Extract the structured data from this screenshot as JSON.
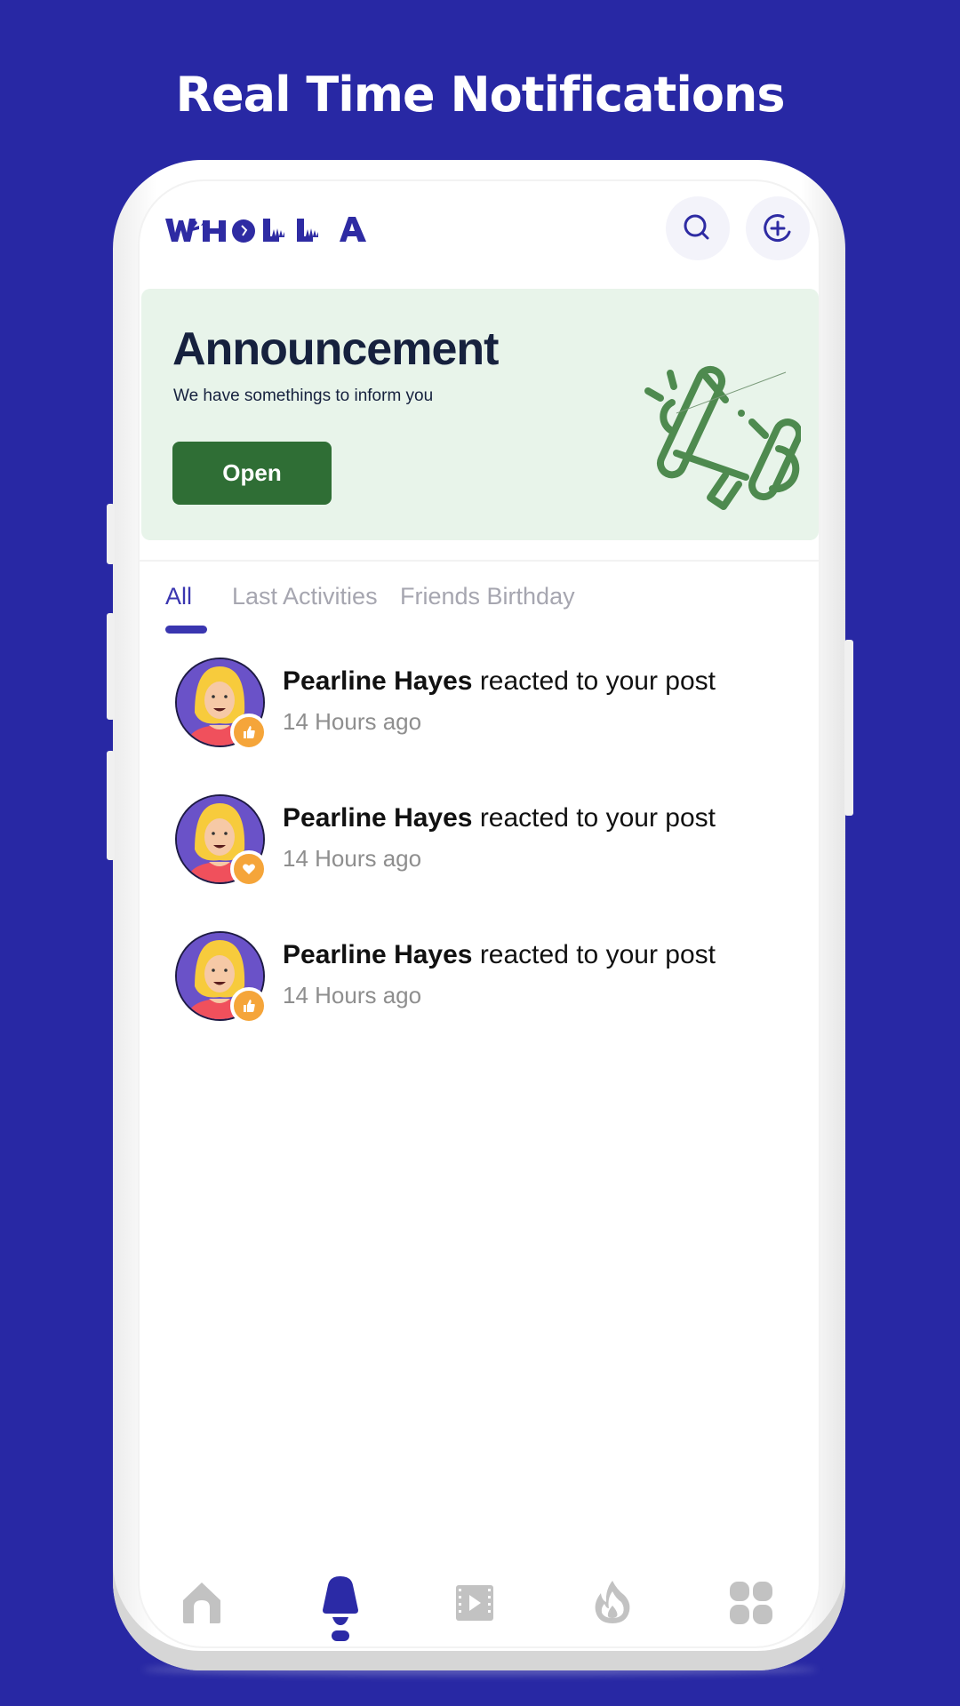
{
  "promo": {
    "title": "Real Time Notifications"
  },
  "colors": {
    "background": "#2828A4",
    "brand": "#2E2BA3",
    "card_bg": "#E8F4EA",
    "open_button": "#2F6E35",
    "reaction_badge": "#F5A53A",
    "nav_inactive": "#C2C2C2"
  },
  "app": {
    "logo_text": "WHOLLA",
    "header": {
      "search_icon": "search-icon",
      "add_icon": "plus-circle-icon"
    },
    "announcement": {
      "title": "Announcement",
      "subtitle": "We have somethings to inform you",
      "button_label": "Open",
      "illustration": "megaphone-icon"
    },
    "tabs": [
      {
        "label": "All",
        "active": true
      },
      {
        "label": "Last Activities",
        "active": false
      },
      {
        "label": "Friends Birthday",
        "active": false
      }
    ],
    "notifications": [
      {
        "name": "Pearline Hayes",
        "action": " reacted to your post",
        "time": "14 Hours ago",
        "reaction": "thumbs-up-icon"
      },
      {
        "name": "Pearline Hayes",
        "action": " reacted to your post",
        "time": "14 Hours ago",
        "reaction": "heart-icon"
      },
      {
        "name": "Pearline Hayes",
        "action": " reacted to your post",
        "time": "14 Hours ago",
        "reaction": "thumbs-up-icon"
      }
    ],
    "bottom_nav": [
      {
        "icon": "home-icon",
        "active": false
      },
      {
        "icon": "bell-icon",
        "active": true
      },
      {
        "icon": "video-icon",
        "active": false
      },
      {
        "icon": "fire-icon",
        "active": false
      },
      {
        "icon": "grid-icon",
        "active": false
      }
    ]
  }
}
